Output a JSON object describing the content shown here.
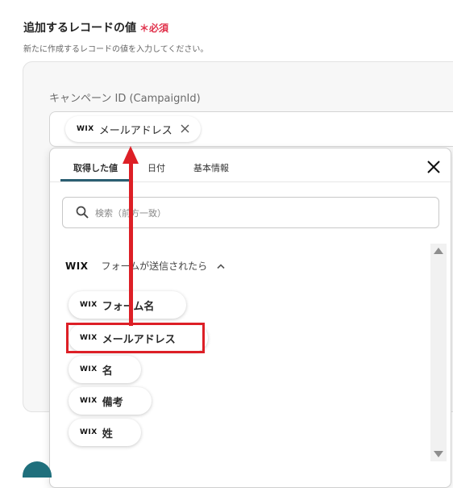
{
  "section": {
    "title": "追加するレコードの値",
    "required_mark": "＊必須",
    "description": "新たに作成するレコードの値を入力してください。"
  },
  "field": {
    "label": "キャンペーン ID (CampaignId)",
    "chip": {
      "service": "WIX",
      "label": "メールアドレス"
    }
  },
  "dropdown": {
    "tabs": [
      {
        "label": "取得した値",
        "active": true
      },
      {
        "label": "日付",
        "active": false
      },
      {
        "label": "基本情報",
        "active": false
      }
    ],
    "search_placeholder": "検索（前方一致）",
    "group": {
      "service": "WIX",
      "title": "フォームが送信されたら",
      "expanded": true
    },
    "items": [
      {
        "service": "WIX",
        "label": "フォーム名"
      },
      {
        "service": "WIX",
        "label": "メールアドレス"
      },
      {
        "service": "WIX",
        "label": "名"
      },
      {
        "service": "WIX",
        "label": "備考"
      },
      {
        "service": "WIX",
        "label": "姓"
      }
    ]
  },
  "colors": {
    "accent": "#2b5e72",
    "annotation": "#dd1f26",
    "required": "#e0314b"
  },
  "icons": {
    "close": "close-icon",
    "search": "search-icon",
    "chevron": "chevron-up-icon",
    "remove": "remove-chip-icon"
  }
}
